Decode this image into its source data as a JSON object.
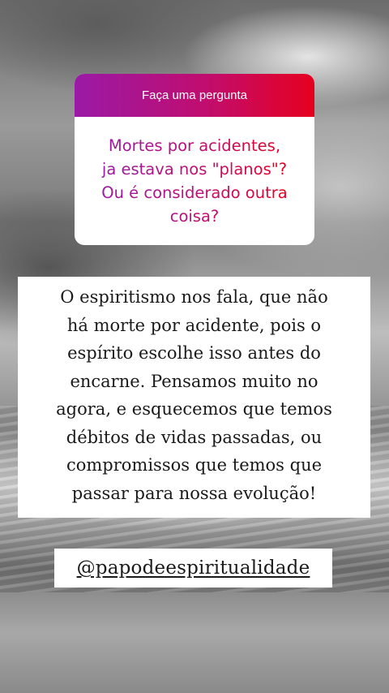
{
  "question_sticker": {
    "header": "Faça uma pergunta",
    "question": "Mortes por acidentes,\nja estava nos \"planos\"?\nOu é considerado outra\ncoisa?"
  },
  "answer": {
    "text": "O espiritismo nos fala, que não\nhá morte por acidente, pois o\nespírito escolhe isso antes do\nencarne. Pensamos muito no\nagora, e esquecemos que temos\ndébitos de vidas passadas, ou\ncompromissos que temos que\npassar para nossa evolução!"
  },
  "handle": {
    "text": "@papodeespiritualidade"
  },
  "colors": {
    "gradient_start": "#9a1aa6",
    "gradient_end": "#e6001f",
    "text_dark": "#1a1a1a"
  }
}
